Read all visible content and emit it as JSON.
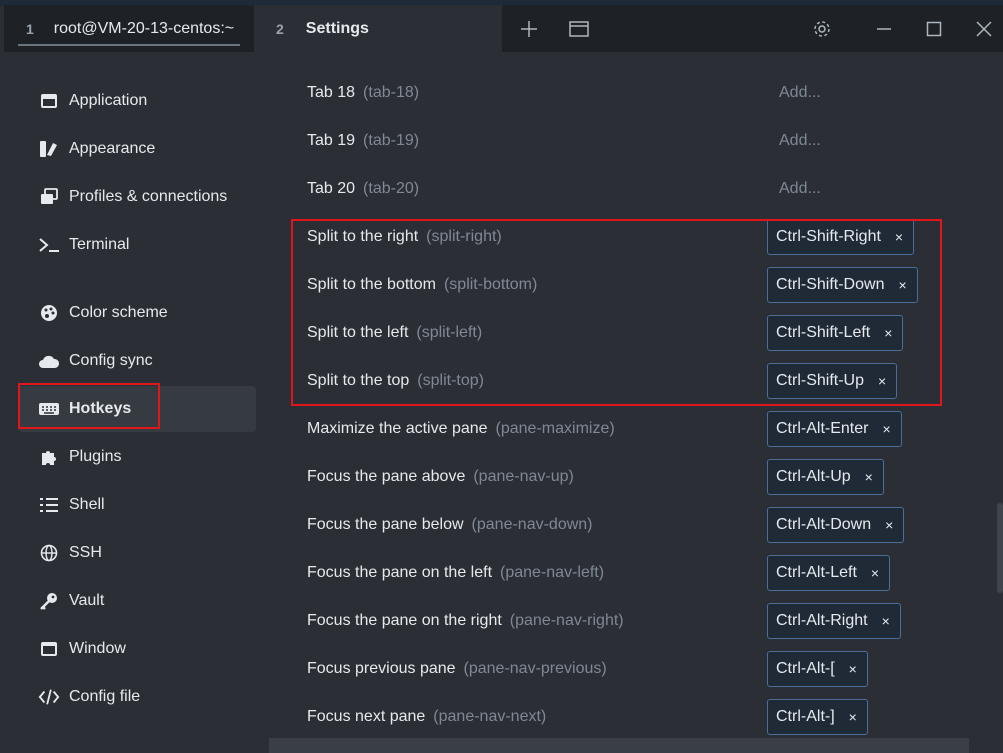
{
  "titlebar": {
    "tabs": [
      {
        "num": "1",
        "title": "root@VM-20-13-centos:~"
      },
      {
        "num": "2",
        "title": "Settings"
      }
    ],
    "icons": [
      "plus-icon",
      "window-icon",
      "gear-icon",
      "minimize-icon",
      "maximize-icon",
      "close-icon"
    ]
  },
  "sidebar": {
    "items": [
      {
        "label": "Application",
        "icon": "application-icon"
      },
      {
        "label": "Appearance",
        "icon": "appearance-icon"
      },
      {
        "label": "Profiles & connections",
        "icon": "profiles-icon"
      },
      {
        "label": "Terminal",
        "icon": "terminal-icon"
      },
      {
        "label": "Color scheme",
        "icon": "palette-icon"
      },
      {
        "label": "Config sync",
        "icon": "cloud-icon"
      },
      {
        "label": "Hotkeys",
        "icon": "keyboard-icon",
        "active": true
      },
      {
        "label": "Plugins",
        "icon": "puzzle-icon"
      },
      {
        "label": "Shell",
        "icon": "list-icon"
      },
      {
        "label": "SSH",
        "icon": "globe-icon"
      },
      {
        "label": "Vault",
        "icon": "key-icon"
      },
      {
        "label": "Window",
        "icon": "window-icon"
      },
      {
        "label": "Config file",
        "icon": "code-icon"
      }
    ]
  },
  "hotkeys": {
    "add_label": "Add...",
    "rows": [
      {
        "name": "Tab 18",
        "id": "(tab-18)",
        "key": ""
      },
      {
        "name": "Tab 19",
        "id": "(tab-19)",
        "key": ""
      },
      {
        "name": "Tab 20",
        "id": "(tab-20)",
        "key": ""
      },
      {
        "name": "Split to the right",
        "id": "(split-right)",
        "key": "Ctrl-Shift-Right"
      },
      {
        "name": "Split to the bottom",
        "id": "(split-bottom)",
        "key": "Ctrl-Shift-Down"
      },
      {
        "name": "Split to the left",
        "id": "(split-left)",
        "key": "Ctrl-Shift-Left"
      },
      {
        "name": "Split to the top",
        "id": "(split-top)",
        "key": "Ctrl-Shift-Up"
      },
      {
        "name": "Maximize the active pane",
        "id": "(pane-maximize)",
        "key": "Ctrl-Alt-Enter"
      },
      {
        "name": "Focus the pane above",
        "id": "(pane-nav-up)",
        "key": "Ctrl-Alt-Up"
      },
      {
        "name": "Focus the pane below",
        "id": "(pane-nav-down)",
        "key": "Ctrl-Alt-Down"
      },
      {
        "name": "Focus the pane on the left",
        "id": "(pane-nav-left)",
        "key": "Ctrl-Alt-Left"
      },
      {
        "name": "Focus the pane on the right",
        "id": "(pane-nav-right)",
        "key": "Ctrl-Alt-Right"
      },
      {
        "name": "Focus previous pane",
        "id": "(pane-nav-previous)",
        "key": "Ctrl-Alt-["
      },
      {
        "name": "Focus next pane",
        "id": "(pane-nav-next)",
        "key": "Ctrl-Alt-]"
      }
    ],
    "remove_glyph": "×"
  },
  "colors": {
    "highlight": "#e0161b",
    "accent_border": "#4a6f96"
  }
}
